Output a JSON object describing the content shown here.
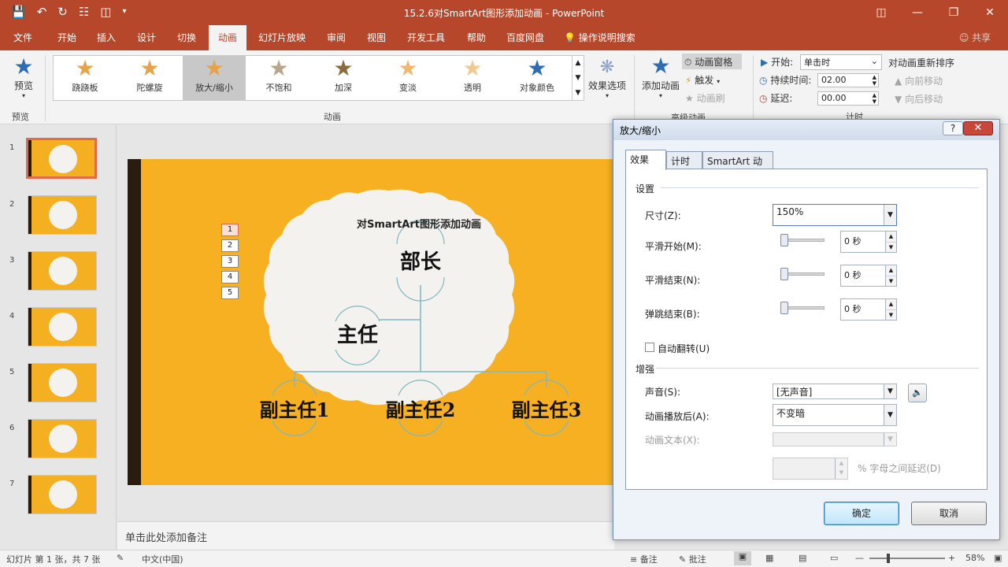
{
  "window": {
    "title": "15.2.6对SmartArt图形添加动画 - PowerPoint"
  },
  "menu": {
    "tabs": [
      "文件",
      "开始",
      "插入",
      "设计",
      "切换",
      "动画",
      "幻灯片放映",
      "审阅",
      "视图",
      "开发工具",
      "帮助",
      "百度网盘"
    ],
    "active": "动画",
    "tell_me": "操作说明搜索",
    "share": "共享"
  },
  "ribbon": {
    "preview_label": "预览",
    "preview_group": "预览",
    "animation_group": "动画",
    "animations": [
      "跷跷板",
      "陀螺旋",
      "放大/缩小",
      "不饱和",
      "加深",
      "变淡",
      "透明",
      "对象颜色"
    ],
    "selected_animation": "放大/缩小",
    "effect_options": "效果选项",
    "add_animation": "添加动画",
    "animation_pane": "动画窗格",
    "trigger": "触发",
    "animation_painter": "动画刷",
    "advanced_group": "高级动画",
    "start_label": "开始:",
    "start_value": "单击时",
    "duration_label": "持续时间:",
    "duration_value": "02.00",
    "delay_label": "延迟:",
    "delay_value": "00.00",
    "reorder_title": "对动画重新排序",
    "move_earlier": "向前移动",
    "move_later": "向后移动",
    "timing_group": "计时"
  },
  "slides": {
    "numbers": [
      "1",
      "2",
      "3",
      "4",
      "5",
      "6",
      "7"
    ]
  },
  "slide": {
    "title": "对SmartArt图形添加动画",
    "nodes": {
      "top": "部长",
      "mid": "主任",
      "b1": "副主任1",
      "b2": "副主任2",
      "b3": "副主任3"
    },
    "markers": [
      "1",
      "2",
      "3",
      "4",
      "5"
    ]
  },
  "notes": {
    "placeholder": "单击此处添加备注"
  },
  "status": {
    "slide_info": "幻灯片 第 1 张，共 7 张",
    "language": "中文(中国)",
    "notes": "备注",
    "comments": "批注",
    "zoom": "58%"
  },
  "dialog": {
    "title": "放大/缩小",
    "tabs": [
      "效果",
      "计时",
      "SmartArt 动画"
    ],
    "settings_section": "设置",
    "size_label": "尺寸(Z):",
    "size_value": "150%",
    "smooth_start_label": "平滑开始(M):",
    "smooth_start_value": "0 秒",
    "smooth_end_label": "平滑结束(N):",
    "smooth_end_value": "0 秒",
    "bounce_end_label": "弹跳结束(B):",
    "bounce_end_value": "0 秒",
    "auto_reverse_label": "自动翻转(U)",
    "enhance_section": "增强",
    "sound_label": "声音(S):",
    "sound_value": "[无声音]",
    "after_anim_label": "动画播放后(A):",
    "after_anim_value": "不变暗",
    "anim_text_label": "动画文本(X):",
    "letter_delay_label": "% 字母之间延迟(D)",
    "ok": "确定",
    "cancel": "取消"
  }
}
